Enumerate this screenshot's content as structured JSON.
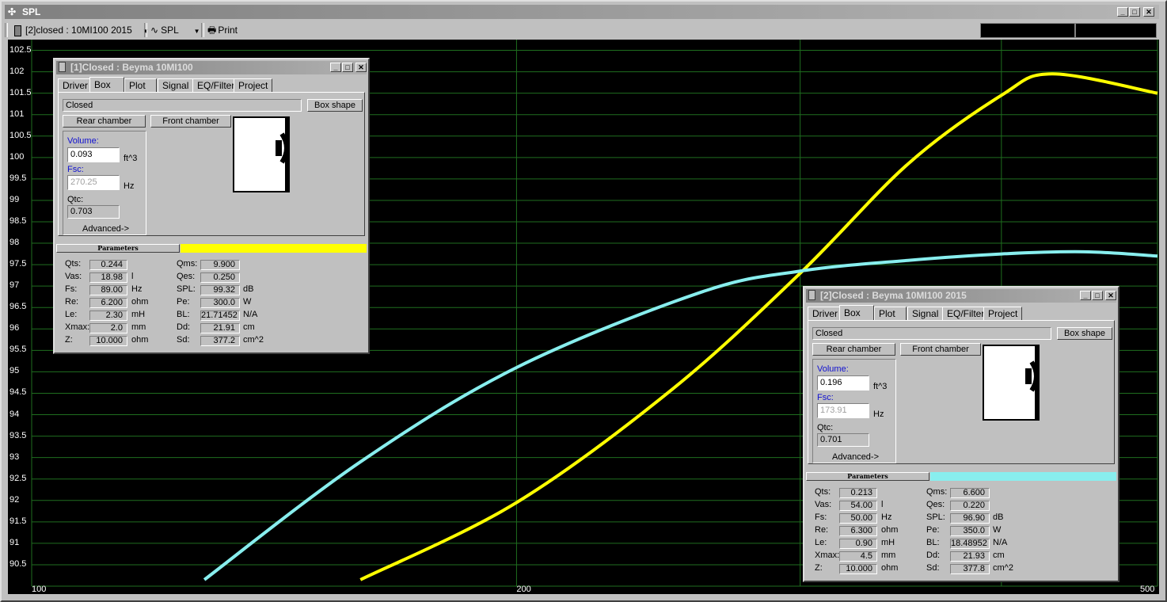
{
  "window": {
    "title": "SPL"
  },
  "toolbar": {
    "selector": "[2]closed : 10MI100 2015",
    "mode": "SPL",
    "print": "Print"
  },
  "colors": {
    "curve1": "#ffff00",
    "curve2": "#88eeee",
    "grid": "#1f6e1f",
    "plot_bg": "#000000"
  },
  "chart_data": {
    "type": "line",
    "x_scale": "log",
    "xlim": [
      100,
      500
    ],
    "ylim": [
      90,
      102.75
    ],
    "x_ticks": [
      "100",
      "200",
      "500"
    ],
    "y_ticks": [
      "102.5",
      "102",
      "101.5",
      "101",
      "100.5",
      "100",
      "99.5",
      "99",
      "98.5",
      "98",
      "97.5",
      "97",
      "96.5",
      "96",
      "95.5",
      "95",
      "94.5",
      "94",
      "93.5",
      "93",
      "92.5",
      "92",
      "91.5",
      "91",
      "90.5"
    ],
    "series": [
      {
        "color": "#ffff00",
        "x": [
          160,
          200,
          250,
          300,
          350,
          400,
          430,
          500
        ],
        "y": [
          90.15,
          91.95,
          94.6,
          97.3,
          99.85,
          101.45,
          101.95,
          101.5
        ]
      },
      {
        "color": "#88eeee",
        "x": [
          128,
          160,
          200,
          260,
          300,
          350,
          400,
          450,
          500
        ],
        "y": [
          90.15,
          92.9,
          95.1,
          96.85,
          97.35,
          97.6,
          97.75,
          97.8,
          97.7
        ]
      }
    ]
  },
  "panels": [
    {
      "title": "[1]Closed : Beyma 10MI100",
      "tabs": [
        "Driver",
        "Box",
        "Plot",
        "Signal",
        "EQ/Filter",
        "Project"
      ],
      "box_type": "Closed",
      "box_shape_btn": "Box shape",
      "rear_btn": "Rear chamber",
      "front_btn": "Front chamber",
      "volume_label": "Volume:",
      "volume": "0.093",
      "volume_unit": "ft^3",
      "fsc_label": "Fsc:",
      "fsc": "270.25",
      "fsc_unit": "Hz",
      "qtc_label": "Qtc:",
      "qtc": "0.703",
      "advanced": "Advanced->",
      "params_label": "Parameters",
      "params_color": "#ffff00",
      "params_left": [
        {
          "name": "Qts:",
          "value": "0.244",
          "unit": ""
        },
        {
          "name": "Vas:",
          "value": "18.98",
          "unit": "l"
        },
        {
          "name": "Fs:",
          "value": "89.00",
          "unit": "Hz"
        },
        {
          "name": "Re:",
          "value": "6.200",
          "unit": "ohm"
        },
        {
          "name": "Le:",
          "value": "2.30",
          "unit": "mH"
        },
        {
          "name": "Xmax:",
          "value": "2.0",
          "unit": "mm"
        },
        {
          "name": "Z:",
          "value": "10.000",
          "unit": "ohm"
        }
      ],
      "params_right": [
        {
          "name": "Qms:",
          "value": "9.900",
          "unit": ""
        },
        {
          "name": "Qes:",
          "value": "0.250",
          "unit": ""
        },
        {
          "name": "SPL:",
          "value": "99.32",
          "unit": "dB"
        },
        {
          "name": "Pe:",
          "value": "300.0",
          "unit": "W"
        },
        {
          "name": "BL:",
          "value": "21.71452",
          "unit": "N/A"
        },
        {
          "name": "Dd:",
          "value": "21.91",
          "unit": "cm"
        },
        {
          "name": "Sd:",
          "value": "377.2",
          "unit": "cm^2"
        }
      ]
    },
    {
      "title": "[2]Closed : Beyma 10MI100 2015",
      "tabs": [
        "Driver",
        "Box",
        "Plot",
        "Signal",
        "EQ/Filter",
        "Project"
      ],
      "box_type": "Closed",
      "box_shape_btn": "Box shape",
      "rear_btn": "Rear chamber",
      "front_btn": "Front chamber",
      "volume_label": "Volume:",
      "volume": "0.196",
      "volume_unit": "ft^3",
      "fsc_label": "Fsc:",
      "fsc": "173.91",
      "fsc_unit": "Hz",
      "qtc_label": "Qtc:",
      "qtc": "0.701",
      "advanced": "Advanced->",
      "params_label": "Parameters",
      "params_color": "#88eeee",
      "params_left": [
        {
          "name": "Qts:",
          "value": "0.213",
          "unit": ""
        },
        {
          "name": "Vas:",
          "value": "54.00",
          "unit": "l"
        },
        {
          "name": "Fs:",
          "value": "50.00",
          "unit": "Hz"
        },
        {
          "name": "Re:",
          "value": "6.300",
          "unit": "ohm"
        },
        {
          "name": "Le:",
          "value": "0.90",
          "unit": "mH"
        },
        {
          "name": "Xmax:",
          "value": "4.5",
          "unit": "mm"
        },
        {
          "name": "Z:",
          "value": "10.000",
          "unit": "ohm"
        }
      ],
      "params_right": [
        {
          "name": "Qms:",
          "value": "6.600",
          "unit": ""
        },
        {
          "name": "Qes:",
          "value": "0.220",
          "unit": ""
        },
        {
          "name": "SPL:",
          "value": "96.90",
          "unit": "dB"
        },
        {
          "name": "Pe:",
          "value": "350.0",
          "unit": "W"
        },
        {
          "name": "BL:",
          "value": "18.48952",
          "unit": "N/A"
        },
        {
          "name": "Dd:",
          "value": "21.93",
          "unit": "cm"
        },
        {
          "name": "Sd:",
          "value": "377.8",
          "unit": "cm^2"
        }
      ]
    }
  ]
}
